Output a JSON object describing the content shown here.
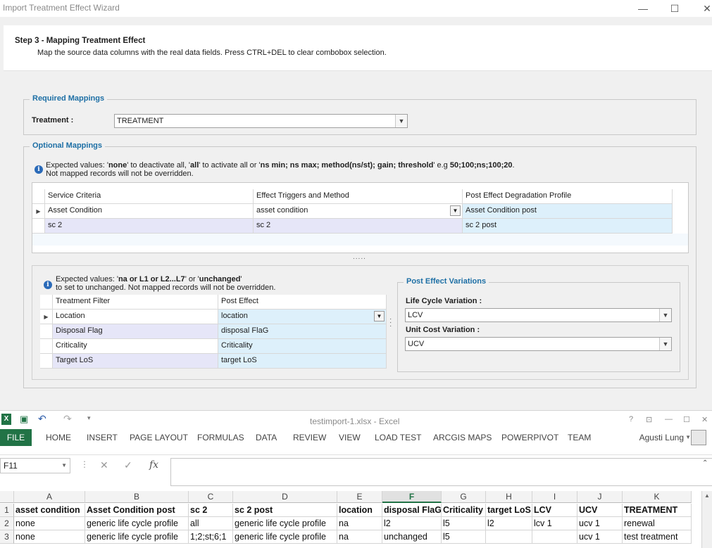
{
  "wizard": {
    "title": "Import Treatment Effect Wizard",
    "controls": {
      "minimize": "—",
      "maximize": "☐",
      "close": "✕"
    },
    "step_title": "Step 3 - Mapping Treatment Effect",
    "step_desc": "Map the source data columns with the real data fields. Press CTRL+DEL to clear combobox selection.",
    "required": {
      "title": "Required Mappings",
      "treatment_label": "Treatment :",
      "treatment_value": "TREATMENT"
    },
    "optional": {
      "title": "Optional Mappings",
      "note_prefix": "Expected values: '",
      "note_none": "none",
      "note_mid1": "' to deactivate all, '",
      "note_all": "all",
      "note_mid2": "' to activate all or '",
      "note_syntax": "ns min; ns max; method(ns/st); gain; threshold",
      "note_mid3": "' e.g ",
      "note_example": "50;100;ns;100;20",
      "note_end": ".",
      "note_line2": "Not mapped records will not be overridden.",
      "grid1": {
        "headers": [
          "Service Criteria",
          "Effect Triggers and Method",
          "Post Effect Degradation Profile"
        ],
        "rows": [
          [
            "Asset Condition",
            "asset condition",
            "Asset Condition post"
          ],
          [
            "sc 2",
            "sc 2",
            "sc 2 post"
          ]
        ]
      },
      "splitter": ".....",
      "note2_prefix": "Expected values: '",
      "note2_vals": "na or L1 or L2...L7",
      "note2_mid": "' or '",
      "note2_unchanged": "unchanged",
      "note2_end": "'",
      "note2_line2": "to set to unchanged. Not mapped records will not be overridden.",
      "grid2": {
        "headers": [
          "Treatment Filter",
          "Post Effect"
        ],
        "rows": [
          [
            "Location",
            "location"
          ],
          [
            "Disposal Flag",
            "disposal FlaG"
          ],
          [
            "Criticality",
            "Criticality"
          ],
          [
            "Target LoS",
            "target LoS"
          ]
        ]
      },
      "variations": {
        "title": "Post Effect Variations",
        "lcv_label": "Life Cycle Variation :",
        "lcv_value": "LCV",
        "ucv_label": "Unit Cost Variation :",
        "ucv_value": "UCV"
      }
    }
  },
  "excel": {
    "title": "testimport-1.xlsx - Excel",
    "title_controls": [
      "?",
      "⊡",
      "—",
      "☐",
      "✕"
    ],
    "tabs": [
      "FILE",
      "HOME",
      "INSERT",
      "PAGE LAYOUT",
      "FORMULAS",
      "DATA",
      "REVIEW",
      "VIEW",
      "LOAD TEST",
      "ARCGIS MAPS",
      "POWERPIVOT",
      "TEAM"
    ],
    "user": "Agusti Lung",
    "namebox": "F11",
    "columns": [
      "A",
      "B",
      "C",
      "D",
      "E",
      "F",
      "G",
      "H",
      "I",
      "J",
      "K"
    ],
    "rows": [
      [
        "asset condition",
        "Asset Condition post",
        "sc 2",
        "sc 2 post",
        "location",
        "disposal FlaG",
        "Criticality",
        "target LoS",
        "LCV",
        "UCV",
        "TREATMENT"
      ],
      [
        "none",
        "generic life cycle profile",
        "all",
        "generic life cycle profile",
        "na",
        "l2",
        "l5",
        "l2",
        "lcv 1",
        "ucv 1",
        "renewal"
      ],
      [
        "none",
        "generic life cycle profile",
        "1;2;st;6;1",
        "generic life cycle profile",
        "na",
        "unchanged",
        "l5",
        "",
        "",
        "ucv 1",
        "test treatment"
      ]
    ],
    "row_numbers": [
      "1",
      "2",
      "3"
    ]
  },
  "colors": {
    "accent": "#1d6fa5",
    "excel_green": "#217346",
    "row_blue": "#ddf0fb",
    "row_lavender": "#e6e6f8"
  }
}
